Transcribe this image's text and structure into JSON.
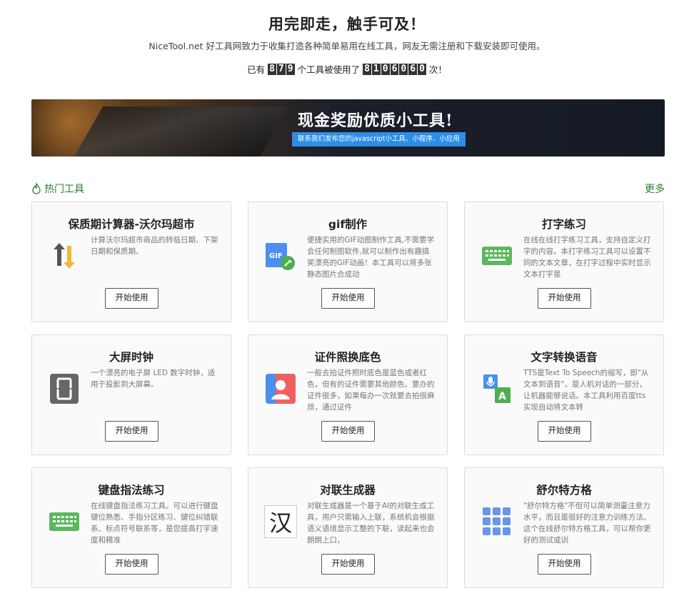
{
  "hero": {
    "title": "用完即走，触手可及！",
    "subtitle": "NiceTool.net 好工具网致力于收集打造各种简单易用在线工具，网友无需注册和下载安装即可使用。",
    "stats_prefix": "已有",
    "tool_count_digits": [
      "8",
      "7",
      "9"
    ],
    "stats_middle": "个工具被使用了",
    "usage_count_digits": [
      "8",
      "1",
      "0",
      "6",
      "0",
      "6",
      "0"
    ],
    "stats_suffix": "次！"
  },
  "banner": {
    "title": "现金奖励优质小工具!",
    "tagline": "联系我们发布您的javascript小工具、小程序、小应用"
  },
  "section": {
    "title": "热门工具",
    "more": "更多",
    "icon": "flame-icon",
    "color": "#2e7d32"
  },
  "tools": [
    {
      "title": "保质期计算器-沃尔玛超市",
      "desc": "计算沃尔玛超市商品的转临日期、下架日期和保质期。",
      "button": "开始使用",
      "icon": "sort-arrows-icon"
    },
    {
      "title": "gif制作",
      "desc": "便捷实用的GIF动图制作工具,不需要学会任何制图软件,就可以制作出有趣搞笑漂亮的GIF动画！本工具可以将多张静态图片合成动",
      "button": "开始使用",
      "icon": "gif-file-icon"
    },
    {
      "title": "打字练习",
      "desc": "在线在线打字练习工具，支持自定义打字的内容。本打字练习工具可以设置不同的文本文章，在打字过程中实时显示文本打字是",
      "button": "开始使用",
      "icon": "keyboard-icon"
    },
    {
      "title": "大屏时钟",
      "desc": "一个漂亮的电子屏 LED 数字时钟，适用于投影到大屏幕。",
      "button": "开始使用",
      "icon": "led-digit-icon"
    },
    {
      "title": "证件照换底色",
      "desc": "一般去拍证件照时底色是蓝色或者红色，但有的证件需要其他颜色。要办的证件很多，如果每办一次就要去拍很麻烦，通过证件",
      "button": "开始使用",
      "icon": "id-photo-icon"
    },
    {
      "title": "文字转换语音",
      "desc": "TTS是Text To Speech的缩写，即\"从文本到语音\"，是人机对话的一部分，让机器能够说话。本工具利用百度tts实现自动将文本转",
      "button": "开始使用",
      "icon": "text-to-speech-icon"
    },
    {
      "title": "键盘指法练习",
      "desc": "在线键盘指法练习工具。可以进行键盘键位熟悉、手指分区练习、键位纠错联系、标点符号联系等，是您提高打字速度和精准",
      "button": "开始使用",
      "icon": "keyboard-icon"
    },
    {
      "title": "对联生成器",
      "desc": "对联生成器是一个基于AI的对联生成工具，用户只需输入上联，系统机会根据语义语境显示工整的下联，读起来也会朗朗上口，",
      "button": "开始使用",
      "icon": "han-character-icon",
      "icon_text": "汉"
    },
    {
      "title": "舒尔特方格",
      "desc": "\"舒尔特方格\"不但可以简单测量注意力水平，而且是很好的注意力训练方法。这个在线舒尔特方格工具，可以帮你更好的测试或训",
      "button": "开始使用",
      "icon": "grid-dots-icon"
    }
  ]
}
